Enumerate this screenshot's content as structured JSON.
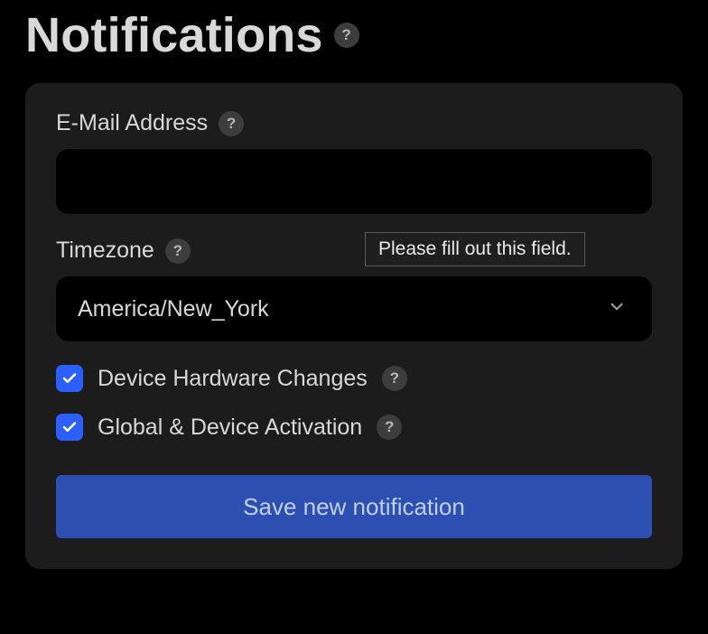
{
  "title": "Notifications",
  "fields": {
    "email": {
      "label": "E-Mail Address",
      "value": ""
    },
    "timezone": {
      "label": "Timezone",
      "value": "America/New_York"
    }
  },
  "tooltip": "Please fill out this field.",
  "checkboxes": {
    "hardware": {
      "label": "Device Hardware Changes",
      "checked": true
    },
    "activation": {
      "label": "Global & Device Activation",
      "checked": true
    }
  },
  "save_label": "Save new notification",
  "help_glyph": "?"
}
